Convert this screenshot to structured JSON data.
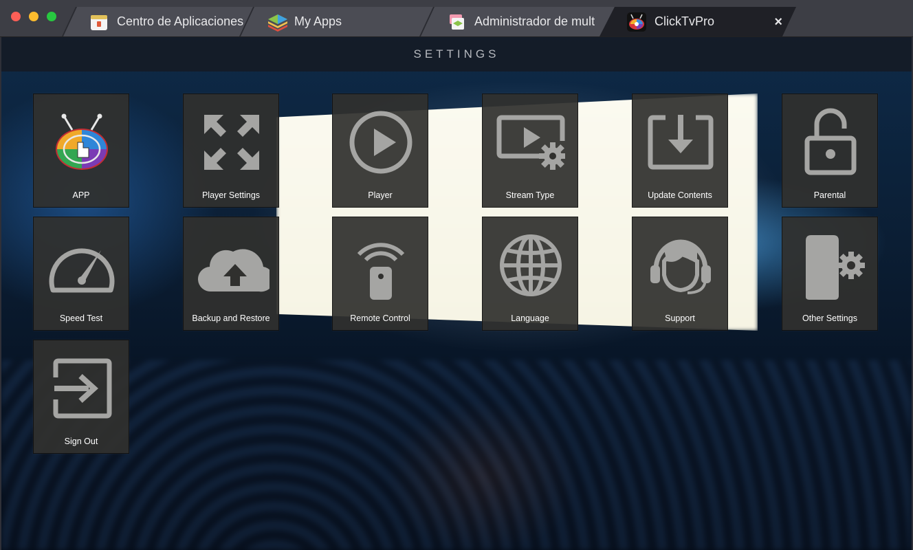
{
  "window": {
    "tabs": [
      {
        "label": "Centro de Aplicaciones",
        "icon": "app-center-icon"
      },
      {
        "label": "My Apps",
        "icon": "bluestacks-icon"
      },
      {
        "label": "Administrador de mult",
        "icon": "multi-instance-icon"
      },
      {
        "label": "ClickTvPro",
        "icon": "clicktvpro-icon",
        "active": true,
        "close": "×"
      }
    ]
  },
  "header": {
    "title": "SETTINGS"
  },
  "tiles": [
    {
      "label": "APP",
      "icon": "tv-logo-icon"
    },
    {
      "label": "Player Settings",
      "icon": "expand-arrows-icon"
    },
    {
      "label": "Player",
      "icon": "play-circle-icon"
    },
    {
      "label": "Stream Type",
      "icon": "video-settings-icon"
    },
    {
      "label": "Update Contents",
      "icon": "download-box-icon"
    },
    {
      "label": "Parental",
      "icon": "unlock-icon"
    },
    {
      "label": "Speed Test",
      "icon": "speedometer-icon"
    },
    {
      "label": "Backup and Restore",
      "icon": "cloud-upload-icon"
    },
    {
      "label": "Remote Control",
      "icon": "remote-control-icon"
    },
    {
      "label": "Language",
      "icon": "globe-icon"
    },
    {
      "label": "Support",
      "icon": "headset-icon"
    },
    {
      "label": "Other Settings",
      "icon": "phone-settings-icon"
    },
    {
      "label": "Sign Out",
      "icon": "sign-out-icon"
    }
  ],
  "colors": {
    "tile_bg": "#30302e",
    "icon": "#a5a5a3",
    "header_text": "#b6b9bf"
  }
}
